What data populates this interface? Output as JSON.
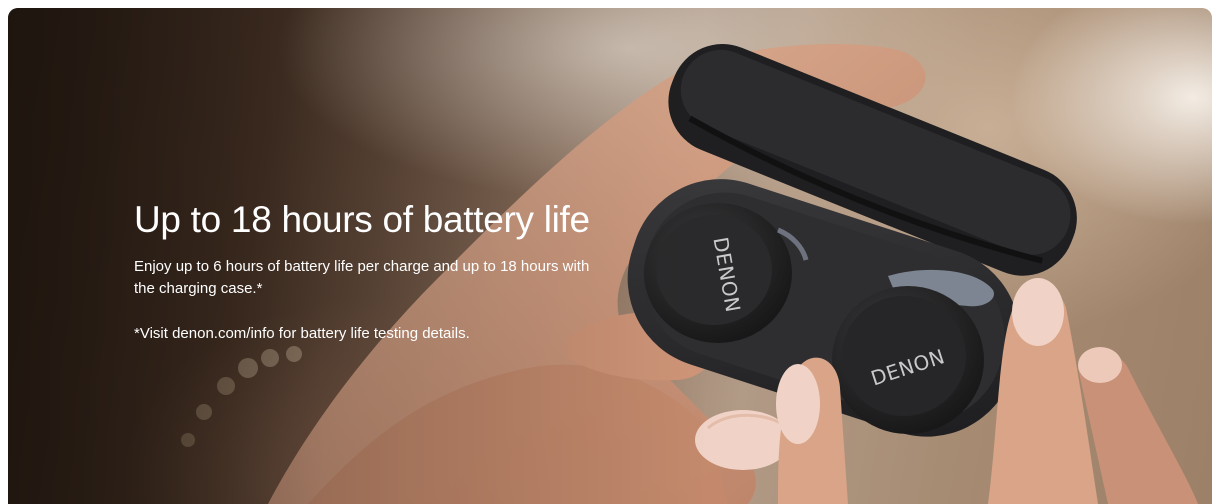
{
  "hero": {
    "headline": "Up to 18 hours of battery life",
    "description": "Enjoy up to 6 hours of battery life per charge and up to 18 hours with the charging case.*",
    "footnote": "*Visit denon.com/info for battery life testing details."
  },
  "image": {
    "brand_mark_left": "DENON",
    "brand_mark_right": "DENON"
  },
  "colors": {
    "text": "#ffffff",
    "case": "#2b2b2d",
    "skin": "#d9a487",
    "nail": "#f0d3c6"
  }
}
